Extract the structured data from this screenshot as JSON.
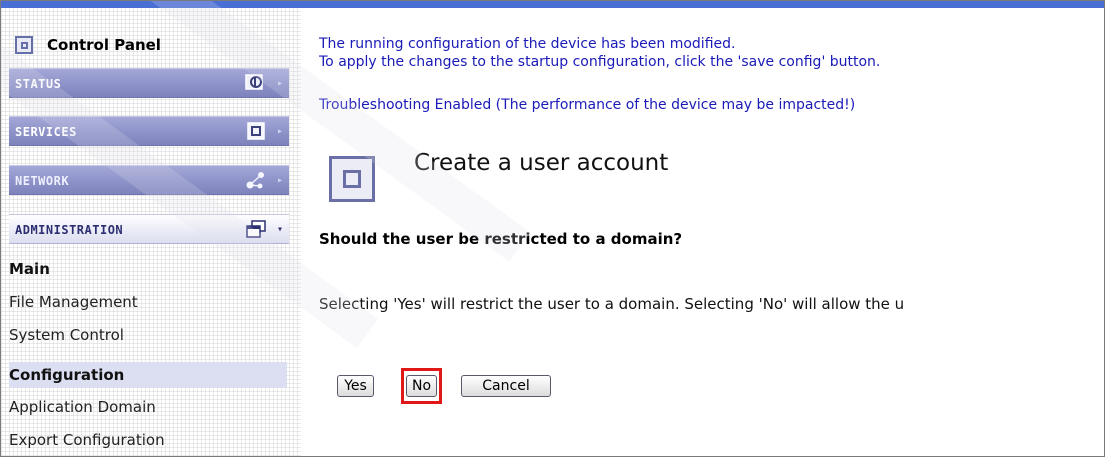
{
  "sidebar": {
    "title": "Control Panel",
    "sections": [
      {
        "label": "STATUS",
        "icon": "status-monitor-icon"
      },
      {
        "label": "SERVICES",
        "icon": "services-box-icon"
      },
      {
        "label": "NETWORK",
        "icon": "network-nodes-icon"
      },
      {
        "label": "ADMINISTRATION",
        "icon": "administration-windows-icon"
      }
    ],
    "menu": [
      {
        "label": "Main",
        "heading": true
      },
      {
        "label": "File Management"
      },
      {
        "label": "System Control"
      },
      {
        "label": "Configuration",
        "heading": true,
        "highlighted": true
      },
      {
        "label": "Application Domain"
      },
      {
        "label": "Export Configuration"
      }
    ]
  },
  "messages": {
    "line1": "The running configuration of the device has been modified.",
    "line2": "To apply the changes to the startup configuration, click the 'save config' button.",
    "troubleshooting": "Troubleshooting Enabled (The performance of the device may be impacted!)"
  },
  "page": {
    "title": "Create a user account",
    "question": "Should the user be restricted to a domain?",
    "description": "Selecting 'Yes' will restrict the user to a domain. Selecting 'No' will allow the u"
  },
  "buttons": {
    "yes": "Yes",
    "no": "No",
    "cancel": "Cancel"
  },
  "colors": {
    "message_text": "#1a1ab8",
    "nav_band": "#8d92c8",
    "highlight_box": "#e01818",
    "top_bar": "#4a6fd4"
  }
}
